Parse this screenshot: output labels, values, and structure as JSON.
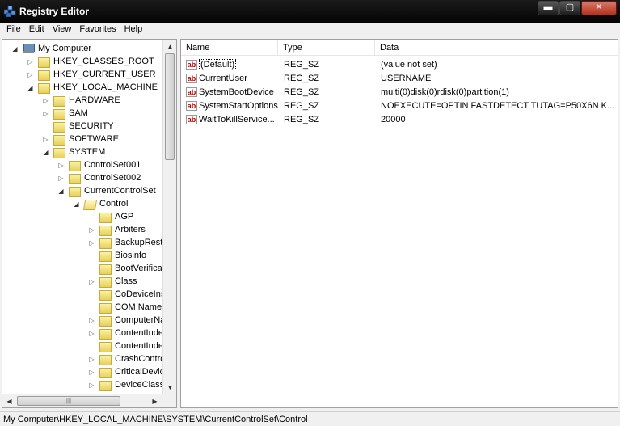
{
  "window": {
    "title": "Registry Editor",
    "minimize": "▬",
    "maximize": "▢",
    "close": "✕"
  },
  "menu": [
    "File",
    "Edit",
    "View",
    "Favorites",
    "Help"
  ],
  "tree": [
    {
      "label": "My Computer",
      "icon": "computer-icon",
      "level": 0,
      "expander": "open"
    },
    {
      "label": "HKEY_CLASSES_ROOT",
      "icon": "folder-icon",
      "level": 1,
      "expander": "closed"
    },
    {
      "label": "HKEY_CURRENT_USER",
      "icon": "folder-icon",
      "level": 1,
      "expander": "closed"
    },
    {
      "label": "HKEY_LOCAL_MACHINE",
      "icon": "folder-icon",
      "level": 1,
      "expander": "open"
    },
    {
      "label": "HARDWARE",
      "icon": "folder-icon",
      "level": 2,
      "expander": "closed"
    },
    {
      "label": "SAM",
      "icon": "folder-icon",
      "level": 2,
      "expander": "closed"
    },
    {
      "label": "SECURITY",
      "icon": "folder-icon",
      "level": 2,
      "expander": "none"
    },
    {
      "label": "SOFTWARE",
      "icon": "folder-icon",
      "level": 2,
      "expander": "closed"
    },
    {
      "label": "SYSTEM",
      "icon": "folder-icon",
      "level": 2,
      "expander": "open"
    },
    {
      "label": "ControlSet001",
      "icon": "folder-icon",
      "level": 3,
      "expander": "closed"
    },
    {
      "label": "ControlSet002",
      "icon": "folder-icon",
      "level": 3,
      "expander": "closed"
    },
    {
      "label": "CurrentControlSet",
      "icon": "folder-icon",
      "level": 3,
      "expander": "open"
    },
    {
      "label": "Control",
      "icon": "open-folder-icon",
      "level": 4,
      "expander": "open"
    },
    {
      "label": "AGP",
      "icon": "folder-icon",
      "level": 5,
      "expander": "none"
    },
    {
      "label": "Arbiters",
      "icon": "folder-icon",
      "level": 5,
      "expander": "closed"
    },
    {
      "label": "BackupReste",
      "icon": "folder-icon",
      "level": 5,
      "expander": "closed"
    },
    {
      "label": "Biosinfo",
      "icon": "folder-icon",
      "level": 5,
      "expander": "none"
    },
    {
      "label": "BootVerifica",
      "icon": "folder-icon",
      "level": 5,
      "expander": "none"
    },
    {
      "label": "Class",
      "icon": "folder-icon",
      "level": 5,
      "expander": "closed"
    },
    {
      "label": "CoDeviceIns",
      "icon": "folder-icon",
      "level": 5,
      "expander": "none"
    },
    {
      "label": "COM Name A",
      "icon": "folder-icon",
      "level": 5,
      "expander": "none"
    },
    {
      "label": "ComputerNa",
      "icon": "folder-icon",
      "level": 5,
      "expander": "closed"
    },
    {
      "label": "ContentInde",
      "icon": "folder-icon",
      "level": 5,
      "expander": "closed"
    },
    {
      "label": "ContentInde",
      "icon": "folder-icon",
      "level": 5,
      "expander": "none"
    },
    {
      "label": "CrashContro",
      "icon": "folder-icon",
      "level": 5,
      "expander": "closed"
    },
    {
      "label": "CriticalDevic",
      "icon": "folder-icon",
      "level": 5,
      "expander": "closed"
    },
    {
      "label": "DeviceClass",
      "icon": "folder-icon",
      "level": 5,
      "expander": "closed"
    }
  ],
  "list": {
    "columns": [
      "Name",
      "Type",
      "Data"
    ],
    "rows": [
      {
        "name": "(Default)",
        "type": "REG_SZ",
        "data": "(value not set)",
        "icon": "ab-icon"
      },
      {
        "name": "CurrentUser",
        "type": "REG_SZ",
        "data": "USERNAME",
        "icon": "ab-icon"
      },
      {
        "name": "SystemBootDevice",
        "type": "REG_SZ",
        "data": "multi(0)disk(0)rdisk(0)partition(1)",
        "icon": "ab-icon"
      },
      {
        "name": "SystemStartOptions",
        "type": "REG_SZ",
        "data": "NOEXECUTE=OPTIN  FASTDETECT  TUTAG=P50X6N  K...",
        "icon": "ab-icon"
      },
      {
        "name": "WaitToKillService...",
        "type": "REG_SZ",
        "data": "20000",
        "icon": "ab-icon"
      }
    ]
  },
  "status": "My Computer\\HKEY_LOCAL_MACHINE\\SYSTEM\\CurrentControlSet\\Control"
}
